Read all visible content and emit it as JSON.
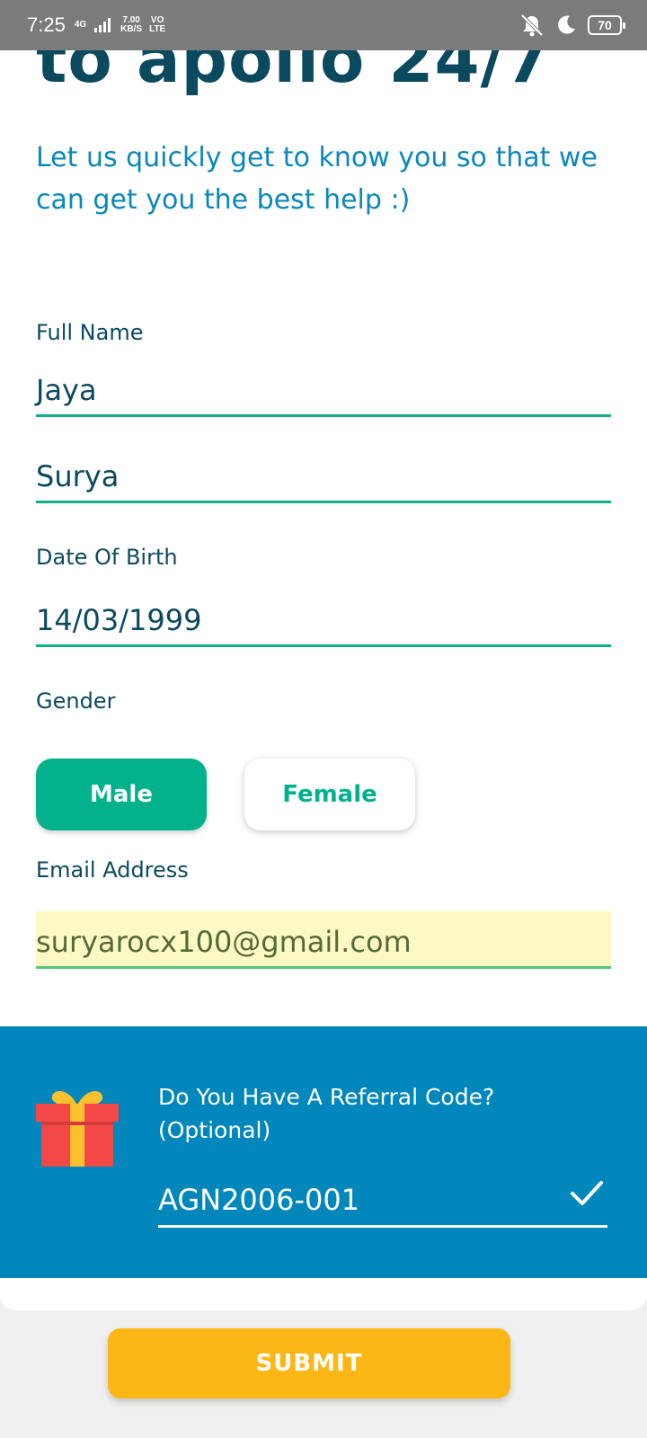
{
  "status_bar": {
    "time": "7:25",
    "network": "4G",
    "speed_value": "7.00",
    "speed_unit": "KB/S",
    "volte_top": "VO",
    "volte_bottom": "LTE",
    "battery": "70"
  },
  "header": {
    "title_cut": "to apollo 24/7",
    "subtitle": "Let us quickly get to know you so that we can get you the best help :)"
  },
  "form": {
    "full_name_label": "Full Name",
    "first_name": "Jaya",
    "last_name": "Surya",
    "dob_label": "Date Of Birth",
    "dob_value": "14/03/1999",
    "gender_label": "Gender",
    "gender_options": [
      "Male",
      "Female"
    ],
    "gender_selected": "Male",
    "email_label": "Email Address",
    "email_value": "suryarocx100@gmail.com"
  },
  "referral": {
    "title_line1": "Do You Have A Referral Code?",
    "title_line2": "(Optional)",
    "code": "AGN2006-001",
    "icon": "gift-icon",
    "check_icon": "check-icon"
  },
  "actions": {
    "submit_label": "SUBMIT"
  },
  "colors": {
    "primary_dark": "#0b4a5e",
    "accent_green": "#02b28c",
    "accent_blue": "#0187bc",
    "submit_yellow": "#fcb716",
    "autofill_bg": "#fdf9c4"
  }
}
